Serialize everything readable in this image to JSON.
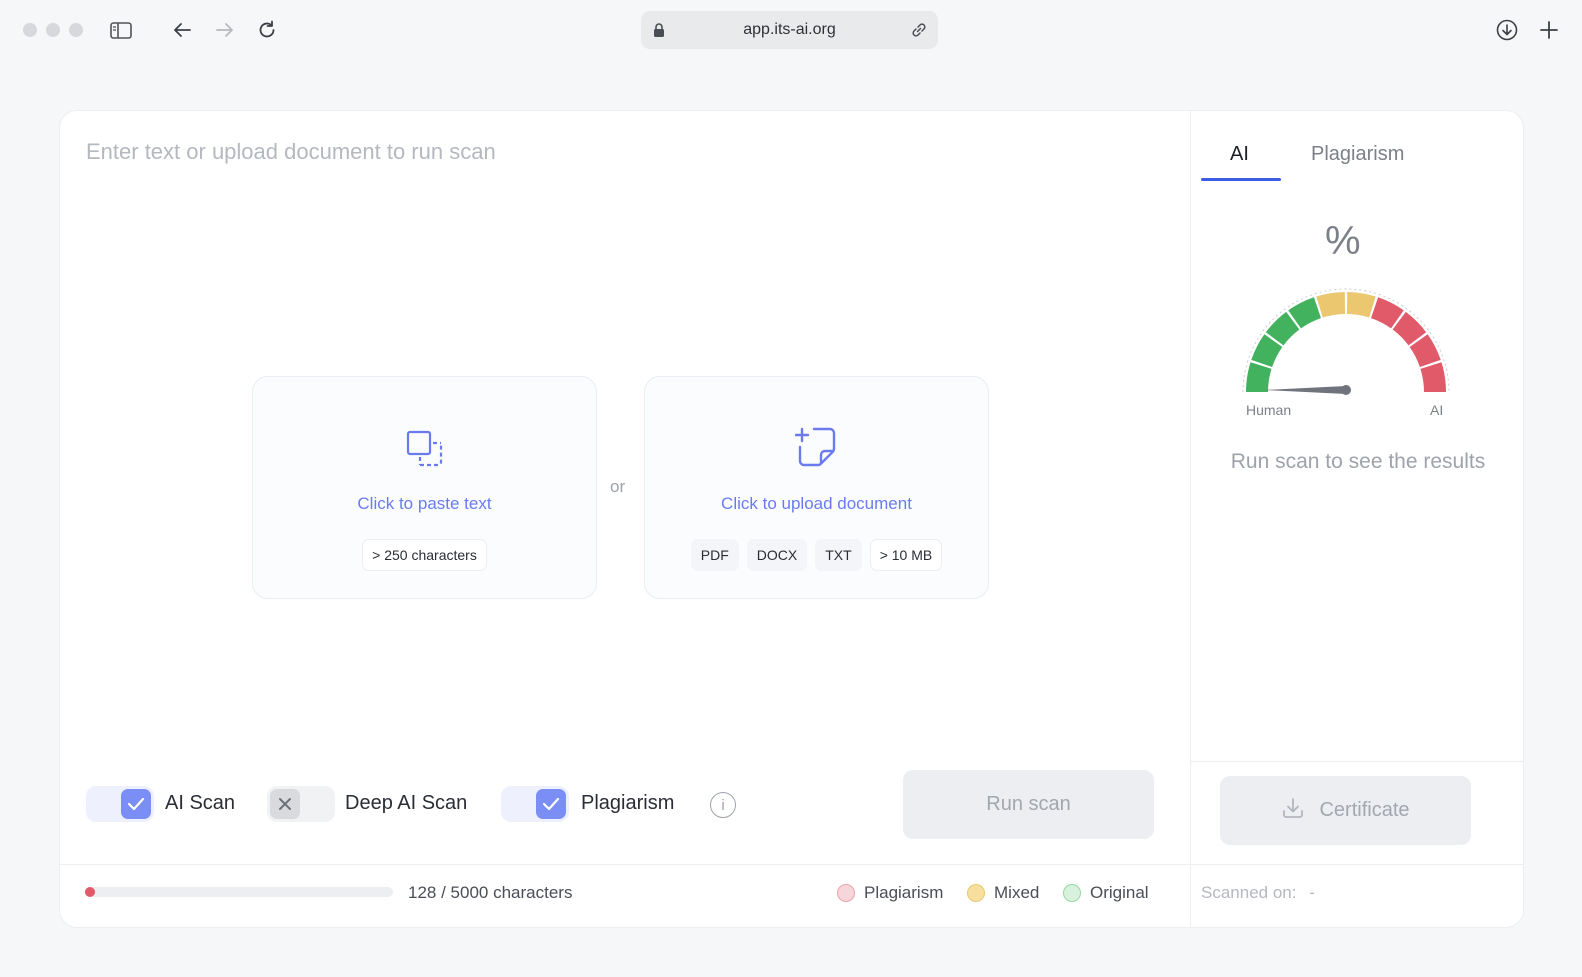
{
  "browser": {
    "url": "app.its-ai.org"
  },
  "editor": {
    "placeholder": "Enter text or upload document to run scan",
    "paste_box": {
      "label": "Click to paste text",
      "chips": [
        "> 250 characters"
      ]
    },
    "or_label": "or",
    "upload_box": {
      "label": "Click to upload document",
      "chips": [
        "PDF",
        "DOCX",
        "TXT",
        "> 10 MB"
      ]
    }
  },
  "options": {
    "ai_scan": {
      "label": "AI Scan",
      "checked": true
    },
    "deep_ai_scan": {
      "label": "Deep AI Scan",
      "checked": false
    },
    "plagiarism": {
      "label": "Plagiarism",
      "checked": true
    },
    "info_glyph": "i"
  },
  "run_button": "Run scan",
  "footer": {
    "count_text": "128 / 5000 characters",
    "progress_fraction": 0.0256,
    "legend": [
      {
        "label": "Plagiarism",
        "color": "#f6d6da",
        "border": "#e8a3ad"
      },
      {
        "label": "Mixed",
        "color": "#f7dfa0",
        "border": "#e9c96c"
      },
      {
        "label": "Original",
        "color": "#d9f2dd",
        "border": "#94d6a0"
      }
    ],
    "scanned_on_label": "Scanned on:",
    "scanned_on_value": "-"
  },
  "results": {
    "tabs": [
      {
        "label": "AI",
        "active": true
      },
      {
        "label": "Plagiarism",
        "active": false
      }
    ],
    "percent_symbol": "%",
    "gauge": {
      "left_label": "Human",
      "right_label": "AI"
    },
    "message": "Run scan to see the results",
    "certificate_button": "Certificate"
  },
  "colors": {
    "accent": "#3d5ce6",
    "link": "#6a7bf0",
    "checkbox": "#7b8ef5",
    "gauge_green": "#43b25e",
    "gauge_yellow": "#ebc76f",
    "gauge_red": "#e05a6a"
  },
  "icons": [
    "sidebar-icon",
    "back-icon",
    "forward-icon",
    "reload-icon",
    "lock-icon",
    "link-icon",
    "download-icon",
    "new-tab-icon",
    "paste-icon",
    "upload-doc-icon",
    "check-icon",
    "x-icon",
    "info-icon",
    "download-arrow-icon"
  ]
}
